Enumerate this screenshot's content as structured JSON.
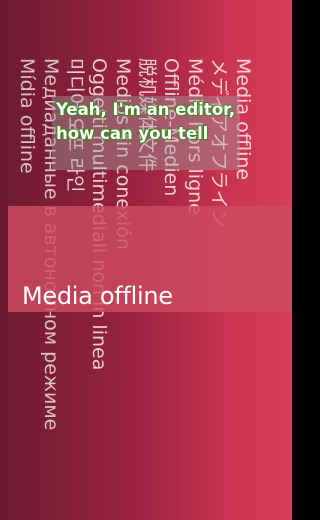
{
  "screen": {
    "background_colors": [
      "#6a1b30",
      "#9a2240",
      "#cc3550",
      "#d43d55"
    ]
  },
  "rotated_labels": [
    "Media offline",
    "メディアオフライン",
    "Média hors ligne",
    "Offline-Medien",
    "脱机媒体文件",
    "Medios sin conexión",
    "Oggetti multimediali non in linea",
    "미디어 오프 라인",
    "Медиаданные в автономном режиме",
    "Mídia offline"
  ],
  "banner": {
    "text": "Media offline",
    "color": "#cd4b5f"
  },
  "caption": {
    "text": "Yeah, I'm an editor, how can you tell",
    "text_color": "#ffffff",
    "outline_color": "#2f7a16"
  }
}
